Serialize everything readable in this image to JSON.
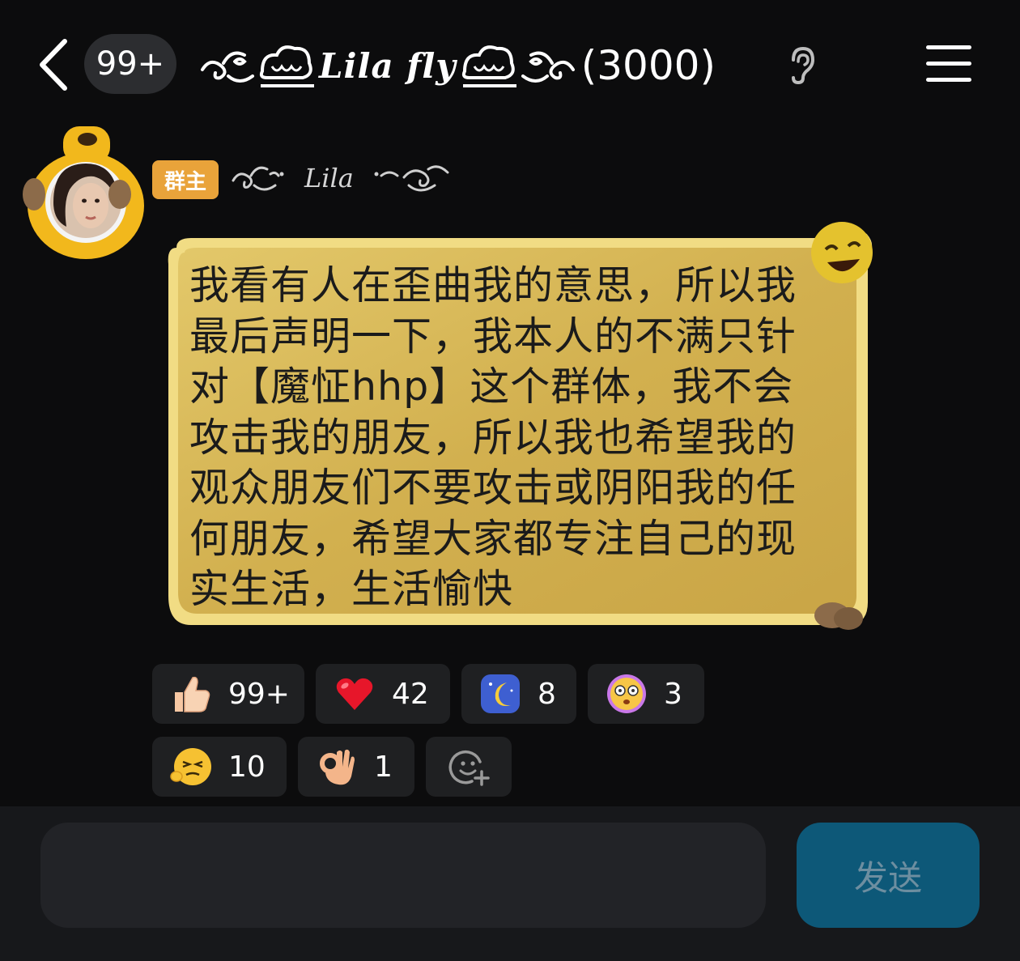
{
  "header": {
    "unread_count": "99+",
    "group_name": "Lila fly",
    "member_count": "(3000)",
    "icons": {
      "back": "chevron-left-icon",
      "listen": "ear-icon",
      "menu": "hamburger-menu-icon"
    }
  },
  "message": {
    "role_badge": "群主",
    "sender_name": "Lila",
    "text": "我看有人在歪曲我的意思，所以我最后声明一下，我本人的不满只针对【魔怔hhp】这个群体，我不会攻击我的朋友，所以我也希望我的观众朋友们不要攻击或阴阳我的任何朋友，希望大家都专注自己的现实生活，生活愉快"
  },
  "reactions": [
    {
      "emoji": "thumbs-up-icon",
      "count": "99+"
    },
    {
      "emoji": "red-heart-icon",
      "count": "42"
    },
    {
      "emoji": "moon-night-icon",
      "count": "8"
    },
    {
      "emoji": "dizzy-face-icon",
      "count": "3"
    },
    {
      "emoji": "smirk-face-icon",
      "count": "10"
    },
    {
      "emoji": "ok-hand-icon",
      "count": "1"
    }
  ],
  "add_reaction_icon": "add-reaction-icon",
  "composer": {
    "input_value": "",
    "send_label": "发送"
  },
  "colors": {
    "background": "#0c0c0d",
    "bubble": "#d7b85a",
    "badge": "#e9a33a",
    "send_button": "#0d5878"
  }
}
